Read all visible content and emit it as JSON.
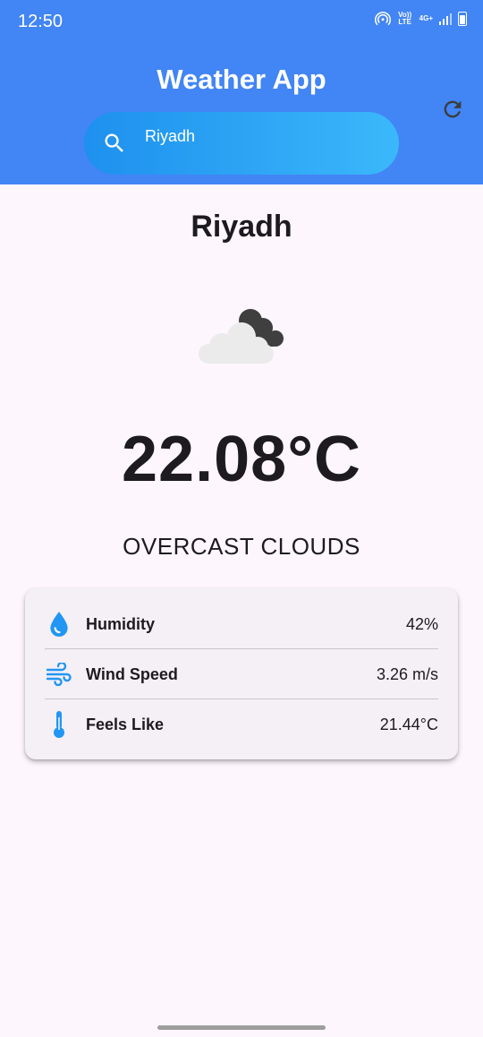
{
  "status_bar": {
    "time": "12:50",
    "volte": "Vo)) LTE",
    "network": "4G+"
  },
  "header": {
    "title": "Weather App"
  },
  "search": {
    "value": "Riyadh"
  },
  "weather": {
    "city": "Riyadh",
    "temperature": "22.08°C",
    "description": "OVERCAST CLOUDS",
    "icon": "overcast-clouds-icon"
  },
  "details": [
    {
      "icon": "humidity-drop-icon",
      "label": "Humidity",
      "value": "42%"
    },
    {
      "icon": "wind-icon",
      "label": "Wind Speed",
      "value": "3.26 m/s"
    },
    {
      "icon": "thermometer-icon",
      "label": "Feels Like",
      "value": "21.44°C"
    }
  ],
  "colors": {
    "header": "#4285f4",
    "accent": "#2196f3",
    "background": "#fdf7fd",
    "card": "#f5eff6"
  }
}
